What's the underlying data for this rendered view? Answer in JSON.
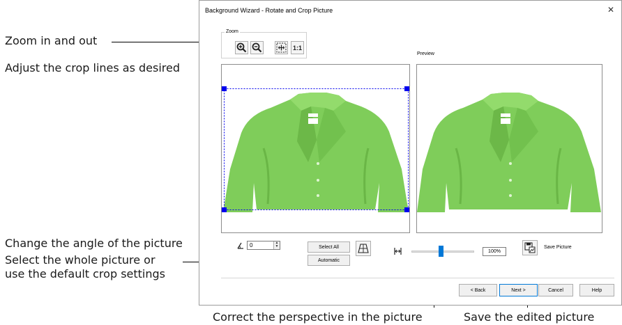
{
  "callouts": {
    "zoom": "Zoom in and out",
    "crop_lines": "Adjust the crop lines as desired",
    "angle": "Change the angle of the picture",
    "select_line1": "Select the whole picture or",
    "select_line2": "use the default crop settings",
    "perspective": "Correct the perspective in the picture",
    "save": "Save the edited picture"
  },
  "dialog": {
    "title": "Background Wizard - Rotate and Crop Picture",
    "close_glyph": "✕",
    "zoom_group_label": "Zoom",
    "zoom_tools": [
      {
        "icon": "zoom-in-icon"
      },
      {
        "icon": "zoom-out-icon"
      },
      {
        "icon": "fit-to-window-icon"
      },
      {
        "icon": "actual-size-icon",
        "label": "1:1"
      }
    ],
    "preview_label": "Preview",
    "angle_value": "0",
    "select_all_label": "Select All",
    "automatic_label": "Automatic",
    "zoom_percent": "100%",
    "slider_level": 0.47,
    "save_picture_label": "Save Picture",
    "buttons": {
      "back": "< Back",
      "next": "Next >",
      "cancel": "Cancel",
      "help": "Help"
    },
    "colors": {
      "shirt": "#7fcd5a",
      "crop_line": "#0000ee",
      "slider_thumb": "#0078d7"
    }
  }
}
